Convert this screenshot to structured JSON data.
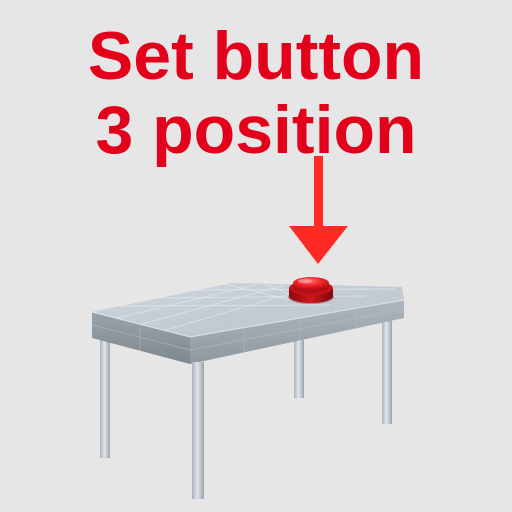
{
  "instruction": {
    "line1": "Set button",
    "line2": "3 position",
    "color": "#e3001b"
  },
  "scene": {
    "background_color": "#e6e6e6",
    "arrow_color": "#ff2a24",
    "button_color": "#e8171c",
    "table_top_color": "#b8c0c8",
    "table_leg_color": "#c4ccd4"
  }
}
